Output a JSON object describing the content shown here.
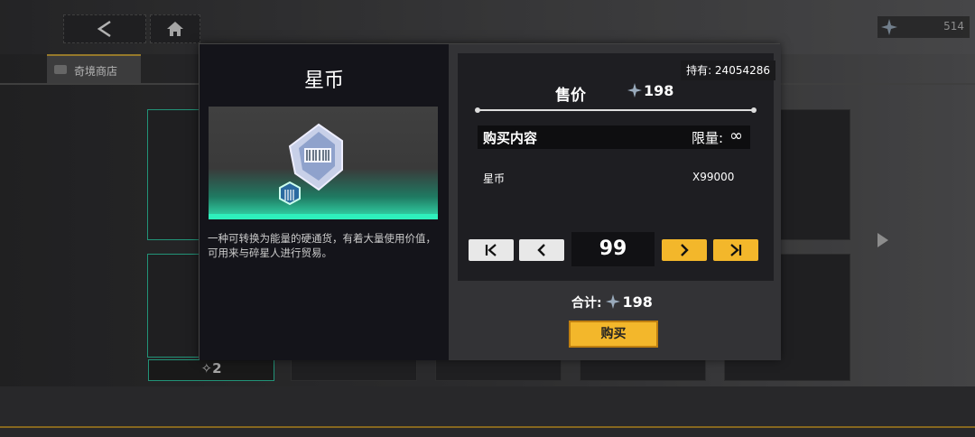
{
  "topbar": {
    "back_icon": "chevron-left-icon",
    "home_icon": "home-icon",
    "currency_value": "514"
  },
  "shop_tab": {
    "label": "奇境商店"
  },
  "background_card_price": "2",
  "item": {
    "title": "星币",
    "description": "一种可转换为能量的硬通货，有着大量使用价值，可用来与碎星人进行贸易。"
  },
  "purchase": {
    "owned": "持有: 24054286",
    "price_label": "售价",
    "price_value": "198",
    "content_label": "购买内容",
    "limit_label": "限量:",
    "limit_value": "∞",
    "item_name": "星币",
    "item_quantity": "X99000",
    "quantity": "99",
    "total_label": "合计:",
    "total_value": "198",
    "buy_label": "购买"
  },
  "colors": {
    "accent_yellow": "#f3b72b",
    "accent_teal": "#2ec4a0"
  }
}
